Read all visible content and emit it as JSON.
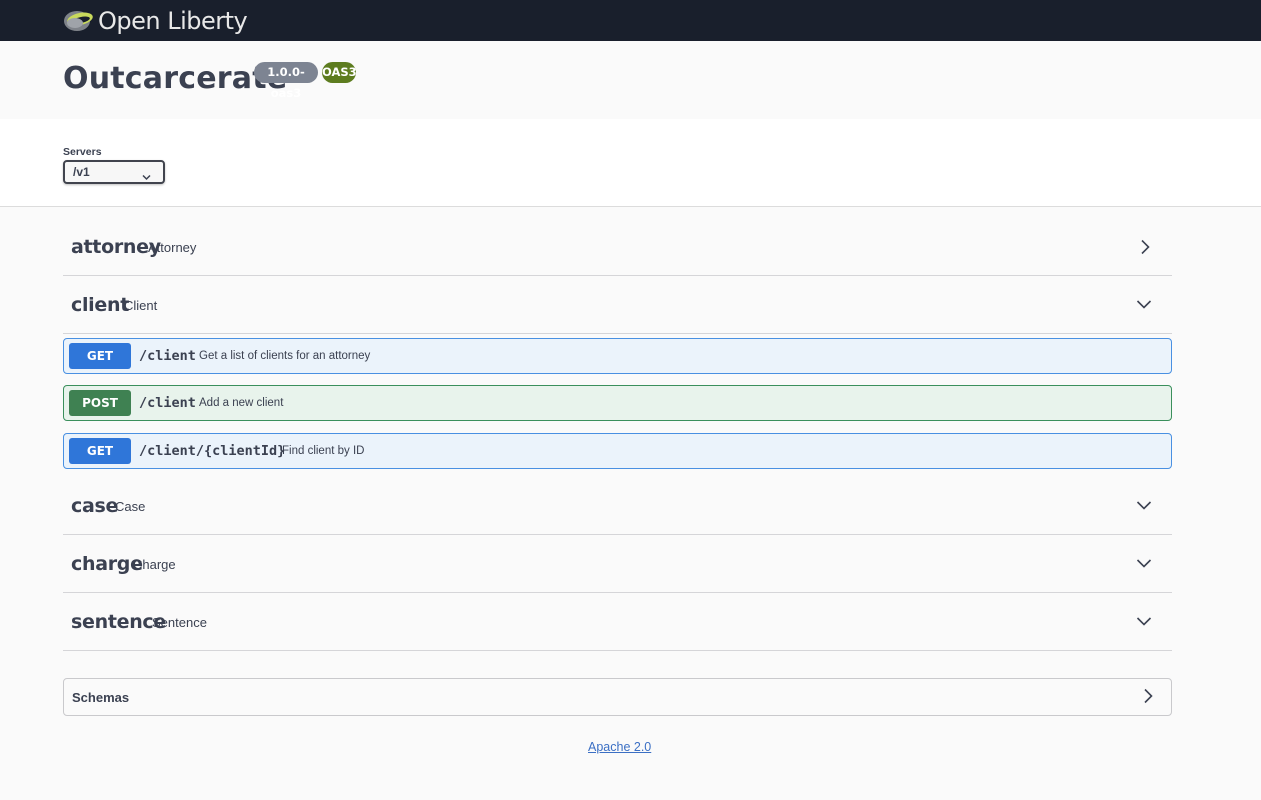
{
  "topbar": {
    "brand_text": "Open Liberty",
    "logo_icon": "open-liberty-logo-icon",
    "colors": {
      "background": "#191f2c"
    }
  },
  "info": {
    "title": "Outcarcerate",
    "version_badge": "1.0.0-oas3",
    "oas_badge": "OAS3"
  },
  "servers": {
    "label": "Servers",
    "selected": "/v1"
  },
  "tags": [
    {
      "name": "attorney",
      "description": "Attorney",
      "expanded": false
    },
    {
      "name": "client",
      "description": "Client",
      "expanded": true,
      "operations": [
        {
          "method": "GET",
          "path": "/client",
          "summary": "Get a list of clients for an attorney"
        },
        {
          "method": "POST",
          "path": "/client",
          "summary": "Add a new client"
        },
        {
          "method": "GET",
          "path": "/client/{clientId}",
          "summary": "Find client by ID"
        }
      ]
    },
    {
      "name": "case",
      "description": "Case",
      "expanded": true
    },
    {
      "name": "charge",
      "description": "Charge",
      "expanded": true
    },
    {
      "name": "sentence",
      "description": "Sentence",
      "expanded": true
    }
  ],
  "schemas": {
    "label": "Schemas"
  },
  "footer": {
    "license": "Apache 2.0"
  },
  "colors": {
    "get": "#2f76d9",
    "post": "#3f8152",
    "text": "#3b4151",
    "oas_badge": "#5d7c1f",
    "version_badge": "#7d8492"
  }
}
